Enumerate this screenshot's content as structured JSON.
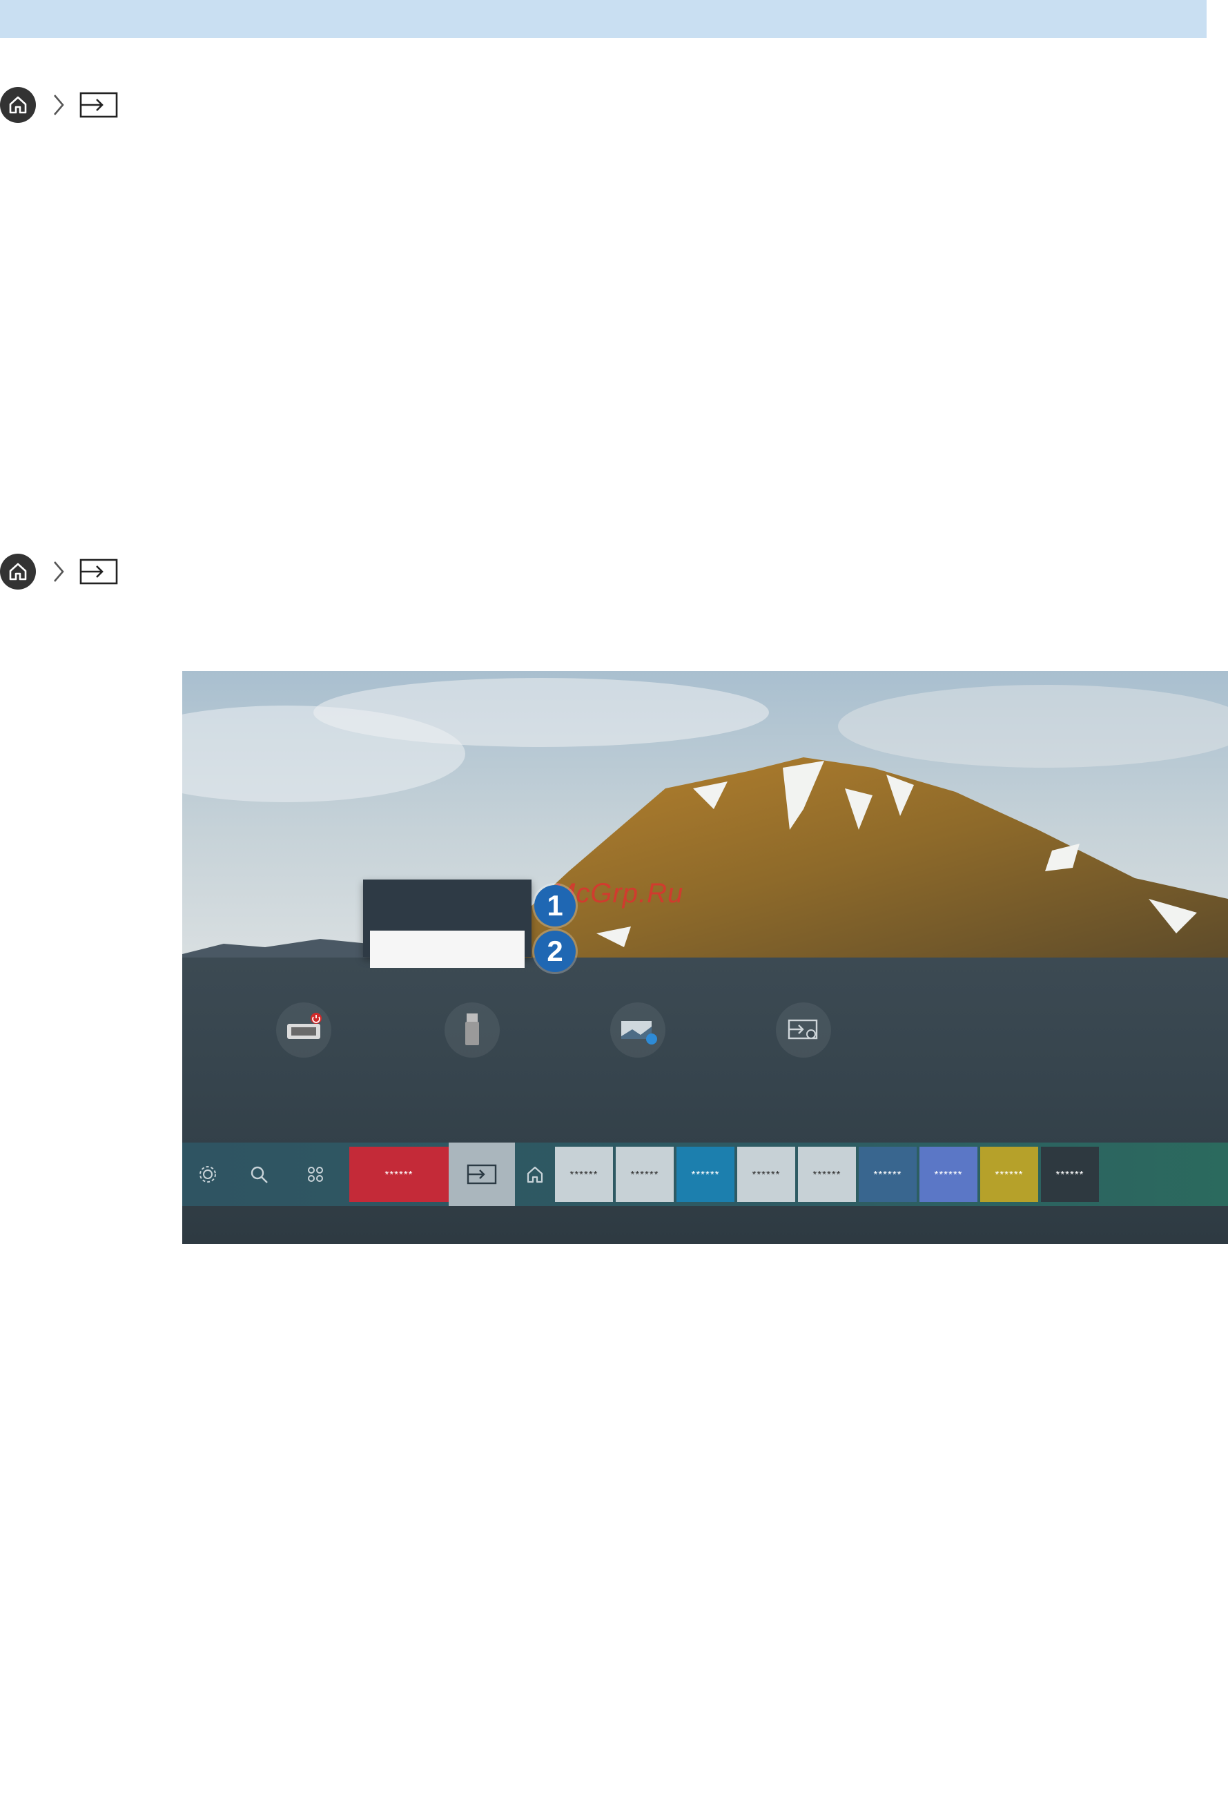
{
  "breadcrumbs": [
    {
      "icons": [
        "home-icon",
        "chevron-right-icon",
        "source-icon"
      ]
    },
    {
      "icons": [
        "home-icon",
        "chevron-right-icon",
        "source-icon"
      ]
    }
  ],
  "tv_screen": {
    "watermark": "McGrp.Ru",
    "callouts": [
      "1",
      "2"
    ],
    "devices": [
      "hdmi-icon",
      "usb-icon",
      "mobile-cast-icon",
      "connection-guide-icon"
    ],
    "taskbar": {
      "icons": [
        "settings-icon",
        "search-icon",
        "apps-icon"
      ],
      "tiles": [
        {
          "label": "******",
          "color": "#c42a38"
        },
        {
          "label": "******",
          "color": "#c7d1d6"
        },
        {
          "label": "******",
          "color": "#c7d1d6"
        },
        {
          "label": "******",
          "color": "#1c7fae"
        },
        {
          "label": "******",
          "color": "#c7d1d6"
        },
        {
          "label": "******",
          "color": "#c7d1d6"
        },
        {
          "label": "******",
          "color": "#39668f"
        },
        {
          "label": "******",
          "color": "#5b77c6"
        },
        {
          "label": "******",
          "color": "#b6a12a"
        },
        {
          "label": "******",
          "color": "#2e3940"
        }
      ]
    }
  }
}
